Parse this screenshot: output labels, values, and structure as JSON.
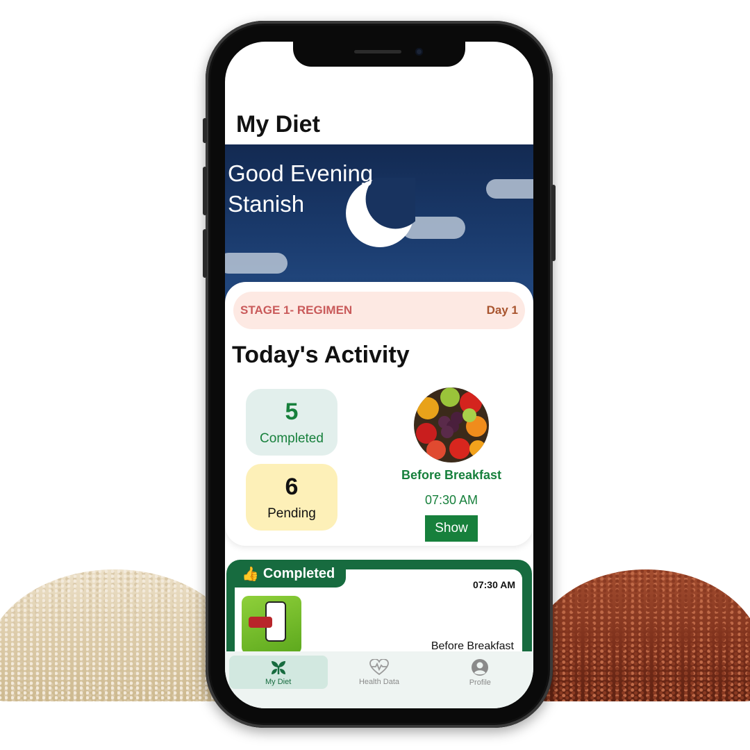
{
  "header": {
    "title": "My Diet"
  },
  "greeting": {
    "line1": "Good Evening",
    "line2": "Stanish"
  },
  "stage": {
    "label": "STAGE 1- REGIMEN",
    "day": "Day 1"
  },
  "activity": {
    "title": "Today's Activity",
    "completed": {
      "count": "5",
      "label": "Completed"
    },
    "pending": {
      "count": "6",
      "label": "Pending"
    },
    "next_meal": {
      "name": "Before Breakfast",
      "time": "07:30 AM",
      "button": "Show"
    }
  },
  "completed_section": {
    "label": "Completed",
    "icon": "thumbs-up-icon",
    "time": "07:30 AM",
    "meal": "Before Breakfast"
  },
  "nav": {
    "items": [
      {
        "label": "My Diet",
        "icon": "sprout-icon",
        "active": true
      },
      {
        "label": "Health Data",
        "icon": "heart-pulse-icon",
        "active": false
      },
      {
        "label": "Profile",
        "icon": "profile-icon",
        "active": false
      }
    ]
  },
  "colors": {
    "brand_green": "#176b3f",
    "accent_green": "#17803c",
    "banner_navy": "#1a3a6c"
  }
}
